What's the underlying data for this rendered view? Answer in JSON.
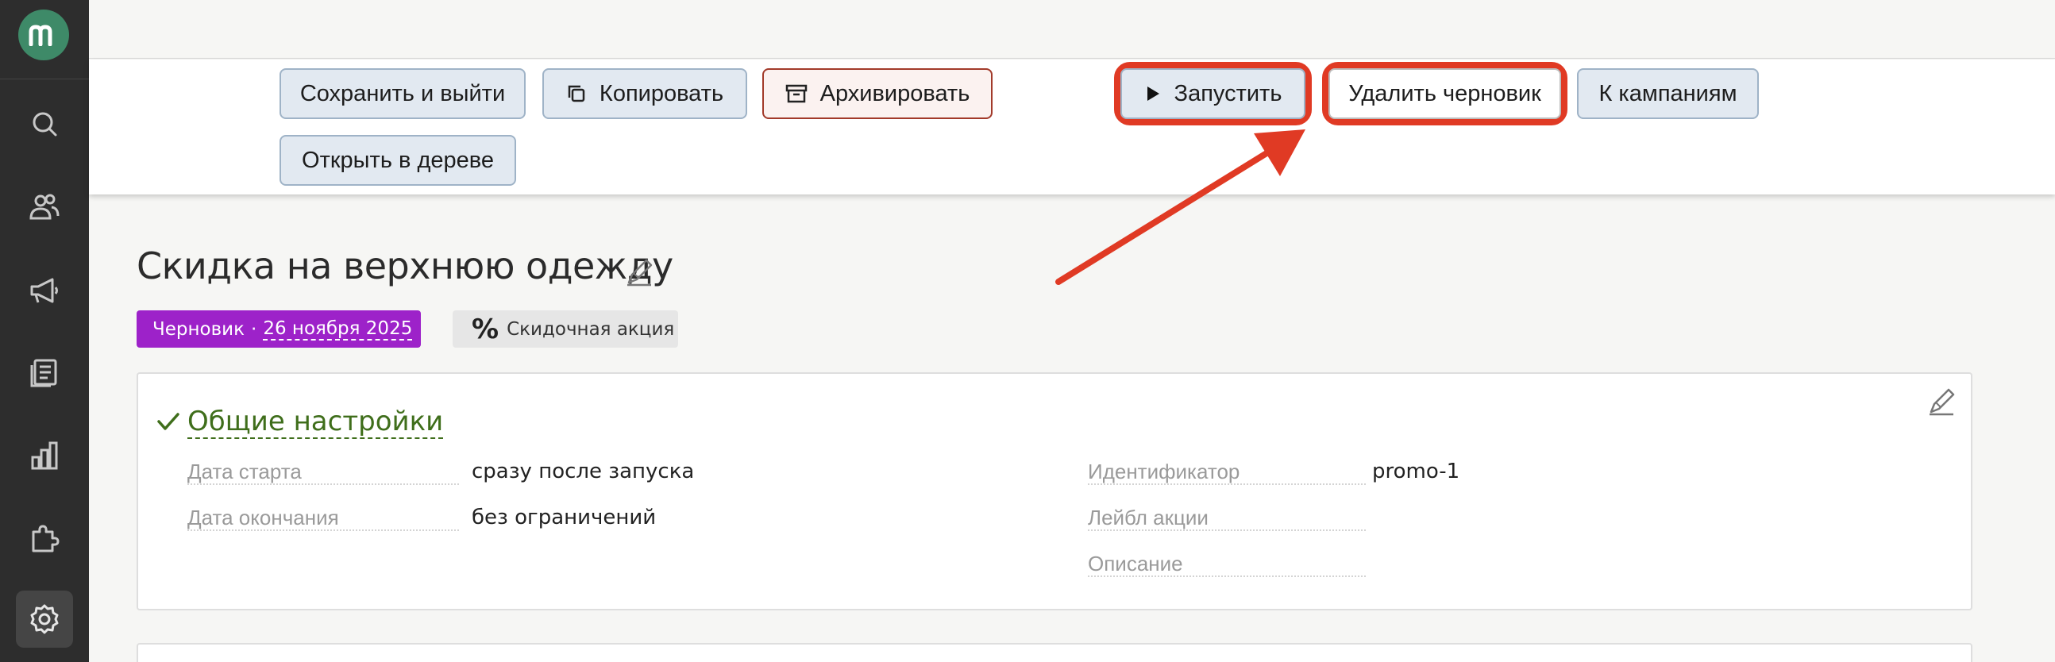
{
  "sidebar": {
    "logo": "m",
    "items": [
      {
        "name": "search-icon"
      },
      {
        "name": "users-icon"
      },
      {
        "name": "megaphone-icon"
      },
      {
        "name": "document-icon"
      },
      {
        "name": "bar-chart-icon"
      },
      {
        "name": "puzzle-icon"
      },
      {
        "name": "gear-icon",
        "active": true
      }
    ]
  },
  "toolbar": {
    "save_exit": "Сохранить и выйти",
    "copy": "Копировать",
    "archive": "Архивировать",
    "launch": "Запустить",
    "delete_draft": "Удалить черновик",
    "to_campaigns": "К кампаниям",
    "open_tree": "Открыть в дереве"
  },
  "page": {
    "title": "Скидка на верхнюю одежду",
    "status": "Черновик",
    "status_sep": "·",
    "status_date": "26 ноября 2025",
    "type_icon": "%",
    "type_label": "Скидочная акция"
  },
  "general": {
    "title": "Общие настройки",
    "start_label": "Дата старта",
    "start_value": "сразу после запуска",
    "end_label": "Дата окончания",
    "end_value": "без ограничений",
    "id_label": "Идентификатор",
    "id_value": "promo-1",
    "promo_label": "Лейбл акции",
    "desc_label": "Описание"
  },
  "colors": {
    "accent_green": "#3f6e1b",
    "status_purple": "#9d22c9",
    "highlight_red": "#e03a24",
    "sidebar_bg": "#2d2d2d",
    "logo_green": "#3e8a68"
  }
}
